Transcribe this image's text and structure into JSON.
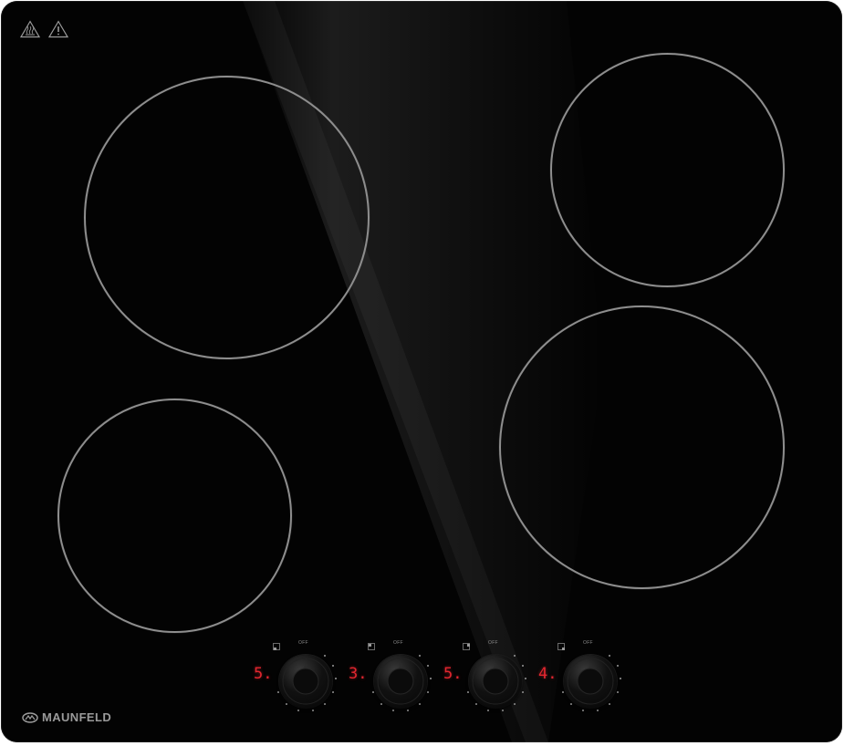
{
  "brand": {
    "name": "MAUNFELD"
  },
  "warnings": [
    {
      "icon": "hot-surface-warning-icon"
    },
    {
      "icon": "caution-warning-icon"
    }
  ],
  "burners": [
    {
      "id": "rear-left"
    },
    {
      "id": "front-left"
    },
    {
      "id": "rear-right"
    },
    {
      "id": "front-right"
    }
  ],
  "controls": [
    {
      "level": "5.",
      "off_label": "OFF",
      "zone_indicator": "front-left"
    },
    {
      "level": "3.",
      "off_label": "OFF",
      "zone_indicator": "rear-left"
    },
    {
      "level": "5.",
      "off_label": "OFF",
      "zone_indicator": "rear-right"
    },
    {
      "level": "4.",
      "off_label": "OFF",
      "zone_indicator": "front-right"
    }
  ],
  "colors": {
    "glass": "#030303",
    "zone_ring": "#8e8e8e",
    "display_red": "#e2262f"
  }
}
